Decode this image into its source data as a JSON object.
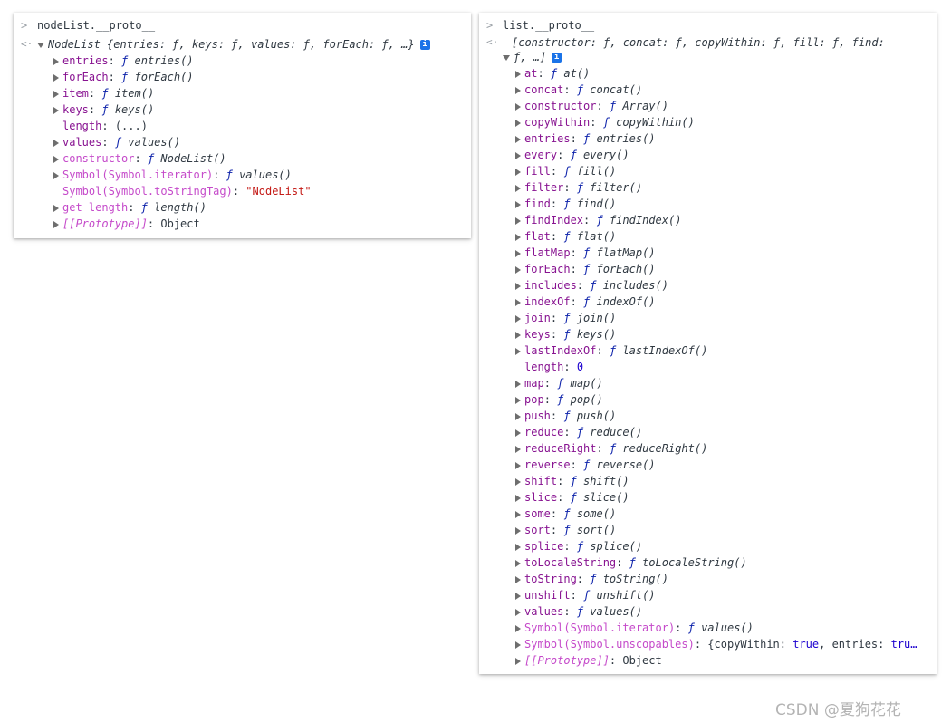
{
  "left": {
    "command": "nodeList.__proto__",
    "summary": "NodeList {entries: ƒ, keys: ƒ, values: ƒ, forEach: ƒ, …}",
    "info_icon": "i",
    "props": [
      {
        "expandable": true,
        "key": "entries",
        "sep": ": ",
        "f": "ƒ",
        "value": " entries()",
        "kind": "fn"
      },
      {
        "expandable": true,
        "key": "forEach",
        "sep": ": ",
        "f": "ƒ",
        "value": " forEach()",
        "kind": "fn"
      },
      {
        "expandable": true,
        "key": "item",
        "sep": ": ",
        "f": "ƒ",
        "value": " item()",
        "kind": "fn"
      },
      {
        "expandable": true,
        "key": "keys",
        "sep": ": ",
        "f": "ƒ",
        "value": " keys()",
        "kind": "fn"
      },
      {
        "expandable": false,
        "key": "length",
        "sep": ": ",
        "f": "",
        "value": "(...)",
        "kind": "plain"
      },
      {
        "expandable": true,
        "key": "values",
        "sep": ": ",
        "f": "ƒ",
        "value": " values()",
        "kind": "fn"
      },
      {
        "expandable": true,
        "key": "constructor",
        "sep": ": ",
        "f": "ƒ",
        "value": " NodeList()",
        "kind": "fn",
        "faded": true
      },
      {
        "expandable": true,
        "key": "Symbol(Symbol.iterator)",
        "sep": ": ",
        "f": "ƒ",
        "value": " values()",
        "kind": "fn",
        "faded": true
      },
      {
        "expandable": false,
        "key": "Symbol(Symbol.toStringTag)",
        "sep": ": ",
        "f": "",
        "value": "\"NodeList\"",
        "kind": "str",
        "faded": true
      },
      {
        "expandable": true,
        "key": "get length",
        "sep": ": ",
        "f": "ƒ",
        "value": " length()",
        "kind": "fn",
        "faded": true
      },
      {
        "expandable": true,
        "key": "[[Prototype]]",
        "sep": ": ",
        "f": "",
        "value": "Object",
        "kind": "plain",
        "proto": true
      }
    ]
  },
  "right": {
    "command": "list.__proto__",
    "summary_line1": "[constructor: ƒ, concat: ƒ, copyWithin: ƒ, fill: ƒ, find:",
    "summary_line2": "ƒ, …]",
    "info_icon": "i",
    "props": [
      {
        "expandable": true,
        "key": "at",
        "sep": ": ",
        "f": "ƒ",
        "value": " at()",
        "kind": "fn"
      },
      {
        "expandable": true,
        "key": "concat",
        "sep": ": ",
        "f": "ƒ",
        "value": " concat()",
        "kind": "fn"
      },
      {
        "expandable": true,
        "key": "constructor",
        "sep": ": ",
        "f": "ƒ",
        "value": " Array()",
        "kind": "fn"
      },
      {
        "expandable": true,
        "key": "copyWithin",
        "sep": ": ",
        "f": "ƒ",
        "value": " copyWithin()",
        "kind": "fn"
      },
      {
        "expandable": true,
        "key": "entries",
        "sep": ": ",
        "f": "ƒ",
        "value": " entries()",
        "kind": "fn"
      },
      {
        "expandable": true,
        "key": "every",
        "sep": ": ",
        "f": "ƒ",
        "value": " every()",
        "kind": "fn"
      },
      {
        "expandable": true,
        "key": "fill",
        "sep": ": ",
        "f": "ƒ",
        "value": " fill()",
        "kind": "fn"
      },
      {
        "expandable": true,
        "key": "filter",
        "sep": ": ",
        "f": "ƒ",
        "value": " filter()",
        "kind": "fn"
      },
      {
        "expandable": true,
        "key": "find",
        "sep": ": ",
        "f": "ƒ",
        "value": " find()",
        "kind": "fn"
      },
      {
        "expandable": true,
        "key": "findIndex",
        "sep": ": ",
        "f": "ƒ",
        "value": " findIndex()",
        "kind": "fn"
      },
      {
        "expandable": true,
        "key": "flat",
        "sep": ": ",
        "f": "ƒ",
        "value": " flat()",
        "kind": "fn"
      },
      {
        "expandable": true,
        "key": "flatMap",
        "sep": ": ",
        "f": "ƒ",
        "value": " flatMap()",
        "kind": "fn"
      },
      {
        "expandable": true,
        "key": "forEach",
        "sep": ": ",
        "f": "ƒ",
        "value": " forEach()",
        "kind": "fn"
      },
      {
        "expandable": true,
        "key": "includes",
        "sep": ": ",
        "f": "ƒ",
        "value": " includes()",
        "kind": "fn"
      },
      {
        "expandable": true,
        "key": "indexOf",
        "sep": ": ",
        "f": "ƒ",
        "value": " indexOf()",
        "kind": "fn"
      },
      {
        "expandable": true,
        "key": "join",
        "sep": ": ",
        "f": "ƒ",
        "value": " join()",
        "kind": "fn"
      },
      {
        "expandable": true,
        "key": "keys",
        "sep": ": ",
        "f": "ƒ",
        "value": " keys()",
        "kind": "fn"
      },
      {
        "expandable": true,
        "key": "lastIndexOf",
        "sep": ": ",
        "f": "ƒ",
        "value": " lastIndexOf()",
        "kind": "fn"
      },
      {
        "expandable": false,
        "key": "length",
        "sep": ": ",
        "f": "",
        "value": "0",
        "kind": "num"
      },
      {
        "expandable": true,
        "key": "map",
        "sep": ": ",
        "f": "ƒ",
        "value": " map()",
        "kind": "fn"
      },
      {
        "expandable": true,
        "key": "pop",
        "sep": ": ",
        "f": "ƒ",
        "value": " pop()",
        "kind": "fn"
      },
      {
        "expandable": true,
        "key": "push",
        "sep": ": ",
        "f": "ƒ",
        "value": " push()",
        "kind": "fn"
      },
      {
        "expandable": true,
        "key": "reduce",
        "sep": ": ",
        "f": "ƒ",
        "value": " reduce()",
        "kind": "fn"
      },
      {
        "expandable": true,
        "key": "reduceRight",
        "sep": ": ",
        "f": "ƒ",
        "value": " reduceRight()",
        "kind": "fn"
      },
      {
        "expandable": true,
        "key": "reverse",
        "sep": ": ",
        "f": "ƒ",
        "value": " reverse()",
        "kind": "fn"
      },
      {
        "expandable": true,
        "key": "shift",
        "sep": ": ",
        "f": "ƒ",
        "value": " shift()",
        "kind": "fn"
      },
      {
        "expandable": true,
        "key": "slice",
        "sep": ": ",
        "f": "ƒ",
        "value": " slice()",
        "kind": "fn"
      },
      {
        "expandable": true,
        "key": "some",
        "sep": ": ",
        "f": "ƒ",
        "value": " some()",
        "kind": "fn"
      },
      {
        "expandable": true,
        "key": "sort",
        "sep": ": ",
        "f": "ƒ",
        "value": " sort()",
        "kind": "fn"
      },
      {
        "expandable": true,
        "key": "splice",
        "sep": ": ",
        "f": "ƒ",
        "value": " splice()",
        "kind": "fn"
      },
      {
        "expandable": true,
        "key": "toLocaleString",
        "sep": ": ",
        "f": "ƒ",
        "value": " toLocaleString()",
        "kind": "fn"
      },
      {
        "expandable": true,
        "key": "toString",
        "sep": ": ",
        "f": "ƒ",
        "value": " toString()",
        "kind": "fn"
      },
      {
        "expandable": true,
        "key": "unshift",
        "sep": ": ",
        "f": "ƒ",
        "value": " unshift()",
        "kind": "fn"
      },
      {
        "expandable": true,
        "key": "values",
        "sep": ": ",
        "f": "ƒ",
        "value": " values()",
        "kind": "fn"
      },
      {
        "expandable": true,
        "key": "Symbol(Symbol.iterator)",
        "sep": ": ",
        "f": "ƒ",
        "value": " values()",
        "kind": "fn",
        "faded": true
      },
      {
        "expandable": true,
        "key": "Symbol(Symbol.unscopables)",
        "sep": ": ",
        "f": "",
        "value": "{copyWithin: true, entries: tru…",
        "kind": "obj",
        "faded": true
      },
      {
        "expandable": true,
        "key": "[[Prototype]]",
        "sep": ": ",
        "f": "",
        "value": "Object",
        "kind": "plain",
        "proto": true
      }
    ]
  },
  "colors": {
    "key": "#881391",
    "key_faded": "#c54aca",
    "function_f": "#0d22aa",
    "string": "#c41a16",
    "number": "#1c00cf",
    "info_icon_bg": "#1a73e8"
  },
  "icons": {
    "prompt": "prompt-chevron-icon",
    "result": "result-arrow-icon",
    "expand": "triangle-right-icon",
    "collapse": "triangle-down-icon",
    "info": "info-icon"
  },
  "watermark": "CSDN @夏狗花花"
}
